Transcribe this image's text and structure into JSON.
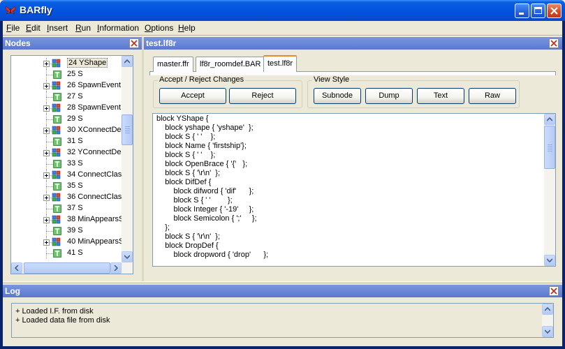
{
  "window": {
    "title": "BARfly"
  },
  "menu": [
    {
      "label": "File",
      "u": "F",
      "rest": "ile"
    },
    {
      "label": "Edit",
      "u": "E",
      "rest": "dit"
    },
    {
      "label": "Insert",
      "u": "I",
      "rest": "nsert"
    },
    {
      "label": "Run",
      "u": "R",
      "rest": "un"
    },
    {
      "label": "Information",
      "u": "I",
      "rest": "nformation"
    },
    {
      "label": "Options",
      "u": "O",
      "rest": "ptions"
    },
    {
      "label": "Help",
      "u": "H",
      "rest": "elp"
    }
  ],
  "nodes_panel": {
    "title": "Nodes",
    "items": [
      {
        "label": "24 YShape",
        "kind": "node",
        "selected": true
      },
      {
        "label": "25 S",
        "kind": "leaf"
      },
      {
        "label": "26 SpawnEvent",
        "kind": "node"
      },
      {
        "label": "27 S",
        "kind": "leaf"
      },
      {
        "label": "28 SpawnEvent",
        "kind": "node"
      },
      {
        "label": "29 S",
        "kind": "leaf"
      },
      {
        "label": "30 XConnectDe",
        "kind": "node"
      },
      {
        "label": "31 S",
        "kind": "leaf"
      },
      {
        "label": "32 YConnectDe",
        "kind": "node"
      },
      {
        "label": "33 S",
        "kind": "leaf"
      },
      {
        "label": "34 ConnectClas",
        "kind": "node"
      },
      {
        "label": "35 S",
        "kind": "leaf"
      },
      {
        "label": "36 ConnectClas",
        "kind": "node"
      },
      {
        "label": "37 S",
        "kind": "leaf"
      },
      {
        "label": "38 MinAppearsS",
        "kind": "node"
      },
      {
        "label": "39 S",
        "kind": "leaf"
      },
      {
        "label": "40 MinAppearsS",
        "kind": "node"
      },
      {
        "label": "41 S",
        "kind": "leaf"
      }
    ]
  },
  "editor_panel": {
    "title": "test.lf8r",
    "tabs": [
      {
        "label": "master.ffr",
        "active": false
      },
      {
        "label": "lf8r_roomdef.BAR",
        "active": false
      },
      {
        "label": "test.lf8r",
        "active": true
      }
    ],
    "accept_group": {
      "label": "Accept / Reject Changes",
      "accept": "Accept",
      "reject": "Reject"
    },
    "view_group": {
      "label": "View Style",
      "subnode": "Subnode",
      "dump": "Dump",
      "text": "Text",
      "raw": "Raw"
    },
    "code_lines": [
      "block YShape {",
      "    block yshape { 'yshape'  };",
      "    block S { ' '    };",
      "    block Name { 'firstship'};",
      "    block S { ' '    };",
      "    block OpenBrace { '{'   };",
      "    block S { '\\r\\n'  };",
      "    block DifDef {",
      "        block difword { 'dif'      };",
      "        block S { ' '        };",
      "        block Integer { '-19'     };",
      "        block Semicolon { ';'     };",
      "    };",
      "    block S { '\\r\\n'  };",
      "    block DropDef {",
      "        block dropword { 'drop'      };"
    ]
  },
  "log_panel": {
    "title": "Log",
    "lines": [
      "+ Loaded I.F. from disk",
      "+ Loaded data file from disk"
    ]
  }
}
